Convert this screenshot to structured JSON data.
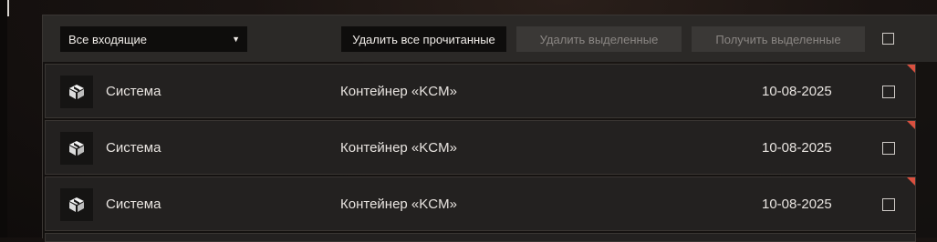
{
  "toolbar": {
    "filter": {
      "selected": "Все входящие"
    },
    "delete_read_label": "Удалить все прочитанные",
    "delete_selected_label": "Удалить выделенные",
    "get_selected_label": "Получить выделенные"
  },
  "messages": [
    {
      "sender": "Система",
      "subject": "Контейнер «KCM»",
      "date": "10-08-2025",
      "unread": true,
      "icon": "crate-icon"
    },
    {
      "sender": "Система",
      "subject": "Контейнер «KCM»",
      "date": "10-08-2025",
      "unread": true,
      "icon": "crate-icon"
    },
    {
      "sender": "Система",
      "subject": "Контейнер «KCM»",
      "date": "10-08-2025",
      "unread": true,
      "icon": "crate-icon"
    }
  ],
  "colors": {
    "accent_unread": "#d9503f",
    "toolbar_bg": "#2b2927",
    "row_bg": "#232120"
  }
}
